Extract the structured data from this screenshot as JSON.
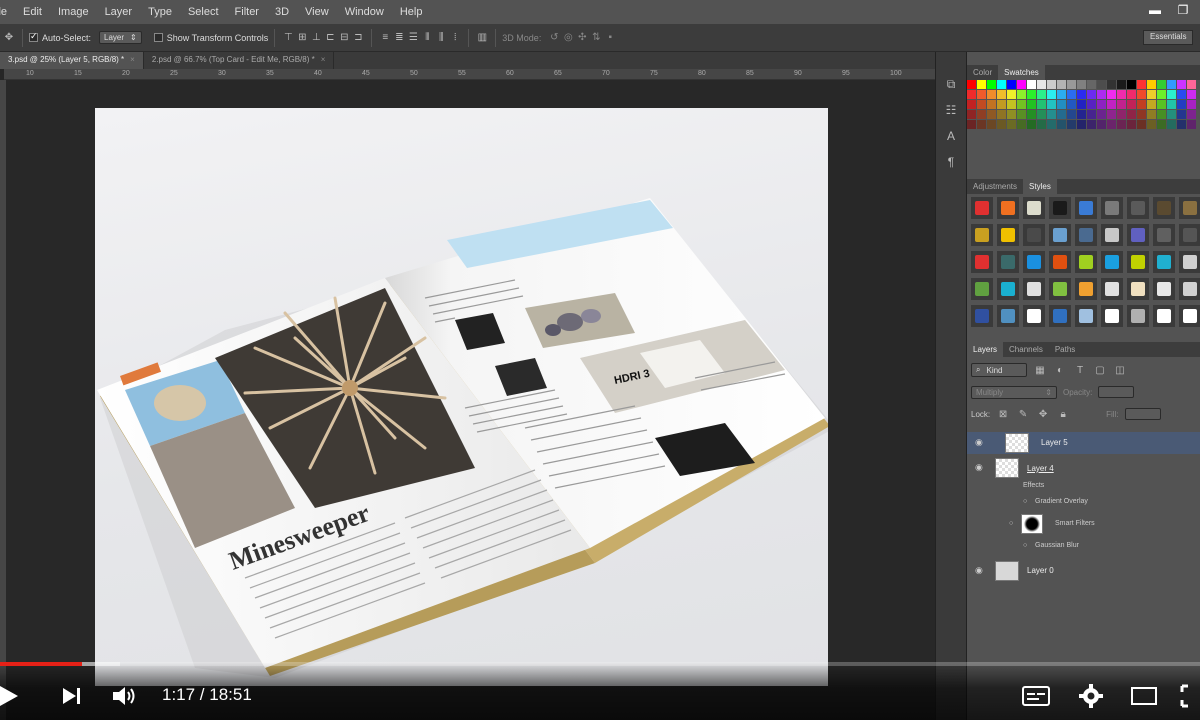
{
  "menu": [
    "ile",
    "Edit",
    "Image",
    "Layer",
    "Type",
    "Select",
    "Filter",
    "3D",
    "View",
    "Window",
    "Help"
  ],
  "options": {
    "auto_select": "Auto-Select:",
    "auto_select_value": "Layer",
    "transform": "Show Transform Controls",
    "mode_3d": "3D Mode:",
    "workspace": "Essentials"
  },
  "tabs": [
    {
      "label": "3.psd @ 25% (Layer 5, RGB/8) *",
      "active": true
    },
    {
      "label": "2.psd @ 66.7% (Top Card - Edit Me, RGB/8) *",
      "active": false
    }
  ],
  "ruler": [
    "10",
    "15",
    "20",
    "25",
    "30",
    "35",
    "40",
    "45",
    "50",
    "55",
    "60",
    "65",
    "70",
    "75",
    "80",
    "85",
    "90",
    "95",
    "100"
  ],
  "panels": {
    "color_tab": "Color",
    "swatches_tab": "Swatches",
    "adjustments_tab": "Adjustments",
    "styles_tab": "Styles",
    "layers_tab": "Layers",
    "channels_tab": "Channels",
    "paths_tab": "Paths",
    "kind": "Kind",
    "blend": "Multiply",
    "opacity": "Opacity:",
    "lock": "Lock:",
    "fill": "Fill:"
  },
  "layers": [
    {
      "name": "Layer 5",
      "selected": true
    },
    {
      "name": "Layer 4",
      "selected": false
    },
    {
      "name": "Effects",
      "kind": "sub"
    },
    {
      "name": "Gradient Overlay",
      "kind": "sub"
    },
    {
      "name": "Smart Filters",
      "kind": "sub"
    },
    {
      "name": "Gaussian Blur",
      "kind": "sub"
    },
    {
      "name": "Layer 0",
      "selected": false
    }
  ],
  "magazine": {
    "headline": "Minesweeper",
    "photo_label": "HDRI 3"
  },
  "video": {
    "time": "1:17 / 18:51",
    "played_fraction": 0.068,
    "buffered_fraction": 0.1
  },
  "colors": {
    "accent_red": "#e62117",
    "selected_layer": "#4a5a75",
    "panel_bg": "#535353",
    "canvas_bg": "#282828"
  }
}
